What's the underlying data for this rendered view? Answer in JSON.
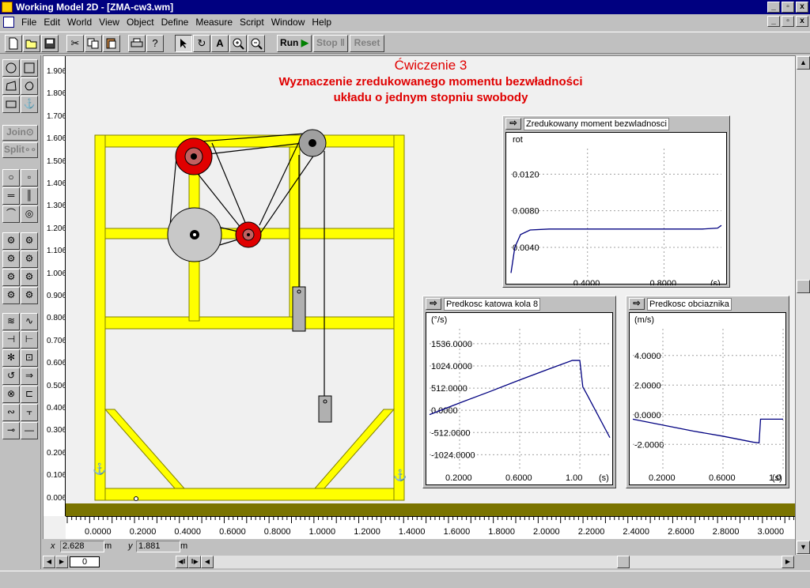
{
  "window": {
    "title": "Working Model 2D - [ZMA-cw3.wm]",
    "caption_buttons": [
      "_",
      "▫",
      "x"
    ]
  },
  "menu": {
    "items": [
      "File",
      "Edit",
      "World",
      "View",
      "Object",
      "Define",
      "Measure",
      "Script",
      "Window",
      "Help"
    ]
  },
  "toolbar": {
    "run_label": "Run",
    "stop_label": "Stop",
    "reset_label": "Reset"
  },
  "palette": {
    "join_label": "Join",
    "split_label": "Split"
  },
  "scene": {
    "title": "Ćwiczenie 3",
    "subtitle_line1": "Wyznaczenie zredukowanego momentu bezwładności",
    "subtitle_line2": "układu o jednym stopniu swobody"
  },
  "rulers": {
    "vertical": [
      "1.906",
      "1.806",
      "1.706",
      "1.606",
      "1.506",
      "1.406",
      "1.306",
      "1.206",
      "1.106",
      "1.006",
      "0.906",
      "0.806",
      "0.706",
      "0.606",
      "0.506",
      "0.406",
      "0.306",
      "0.206",
      "0.106",
      "0.006"
    ],
    "horizontal": [
      "0.0000",
      "0.2000",
      "0.4000",
      "0.6000",
      "0.8000",
      "1.0000",
      "1.2000",
      "1.4000",
      "1.6000",
      "1.8000",
      "2.0000",
      "2.2000",
      "2.4000",
      "2.6000",
      "2.8000",
      "3.0000"
    ]
  },
  "coords": {
    "x_label": "x",
    "x_value": "2.628",
    "x_unit": "m",
    "y_label": "y",
    "y_value": "1.881",
    "y_unit": "m"
  },
  "playback": {
    "frame": "0"
  },
  "colors": {
    "frame_yellow": "#ffff00",
    "pulley_red": "#e00000",
    "pulley_gray": "#c8c8c8",
    "ground": "#7a7400",
    "plot_line": "#000080",
    "title_red": "#e00000"
  },
  "chart_data": [
    {
      "type": "line",
      "title": "Zredukowany moment bezwladnosci",
      "ylabel": "rot",
      "xlabel": "(s)",
      "x_ticks": [
        "0.4000",
        "0.8000"
      ],
      "y_ticks": [
        "0.0120",
        "0.0080",
        "0.0040"
      ],
      "xlim": [
        0,
        1.1
      ],
      "ylim": [
        0.0008,
        0.0148
      ],
      "grid": true,
      "series": [
        {
          "x": [
            0.0,
            0.02,
            0.05,
            0.1,
            0.2,
            0.4,
            0.6,
            0.8,
            1.0,
            1.08,
            1.1
          ],
          "y": [
            0.0012,
            0.004,
            0.0054,
            0.0059,
            0.006,
            0.006,
            0.006,
            0.006,
            0.006,
            0.0061,
            0.0064
          ]
        }
      ]
    },
    {
      "type": "line",
      "title": "Predkosc katowa kola 8",
      "ylabel": "(°/s)",
      "xlabel": "(s)",
      "x_ticks": [
        "0.2000",
        "0.6000",
        "1.00"
      ],
      "y_ticks": [
        "1536.0000",
        "1024.0000",
        "512.0000",
        "0.0000",
        "-512.0000",
        "-1024.0000"
      ],
      "xlim": [
        0,
        1.2
      ],
      "ylim": [
        -1400,
        1880
      ],
      "grid": true,
      "series": [
        {
          "x": [
            0.0,
            0.2,
            0.4,
            0.6,
            0.8,
            0.95,
            1.0,
            1.02,
            1.05,
            1.2
          ],
          "y": [
            -100,
            170,
            430,
            700,
            960,
            1150,
            1150,
            540,
            350,
            -630
          ]
        }
      ]
    },
    {
      "type": "line",
      "title": "Predkosc obciaznika",
      "ylabel": "(m/s)",
      "xlabel": "(s)",
      "x_ticks": [
        "0.2000",
        "0.6000",
        "1.0"
      ],
      "y_ticks": [
        "4.0000",
        "2.0000",
        "0.0000",
        "-2.0000"
      ],
      "xlim": [
        0,
        1.0
      ],
      "ylim": [
        -3.8,
        5.8
      ],
      "grid": true,
      "series": [
        {
          "x": [
            0.0,
            0.2,
            0.4,
            0.6,
            0.8,
            0.84,
            0.85,
            0.9,
            1.0
          ],
          "y": [
            -0.3,
            -0.7,
            -1.1,
            -1.45,
            -1.85,
            -1.9,
            -0.3,
            -0.3,
            -0.3
          ]
        }
      ]
    }
  ]
}
